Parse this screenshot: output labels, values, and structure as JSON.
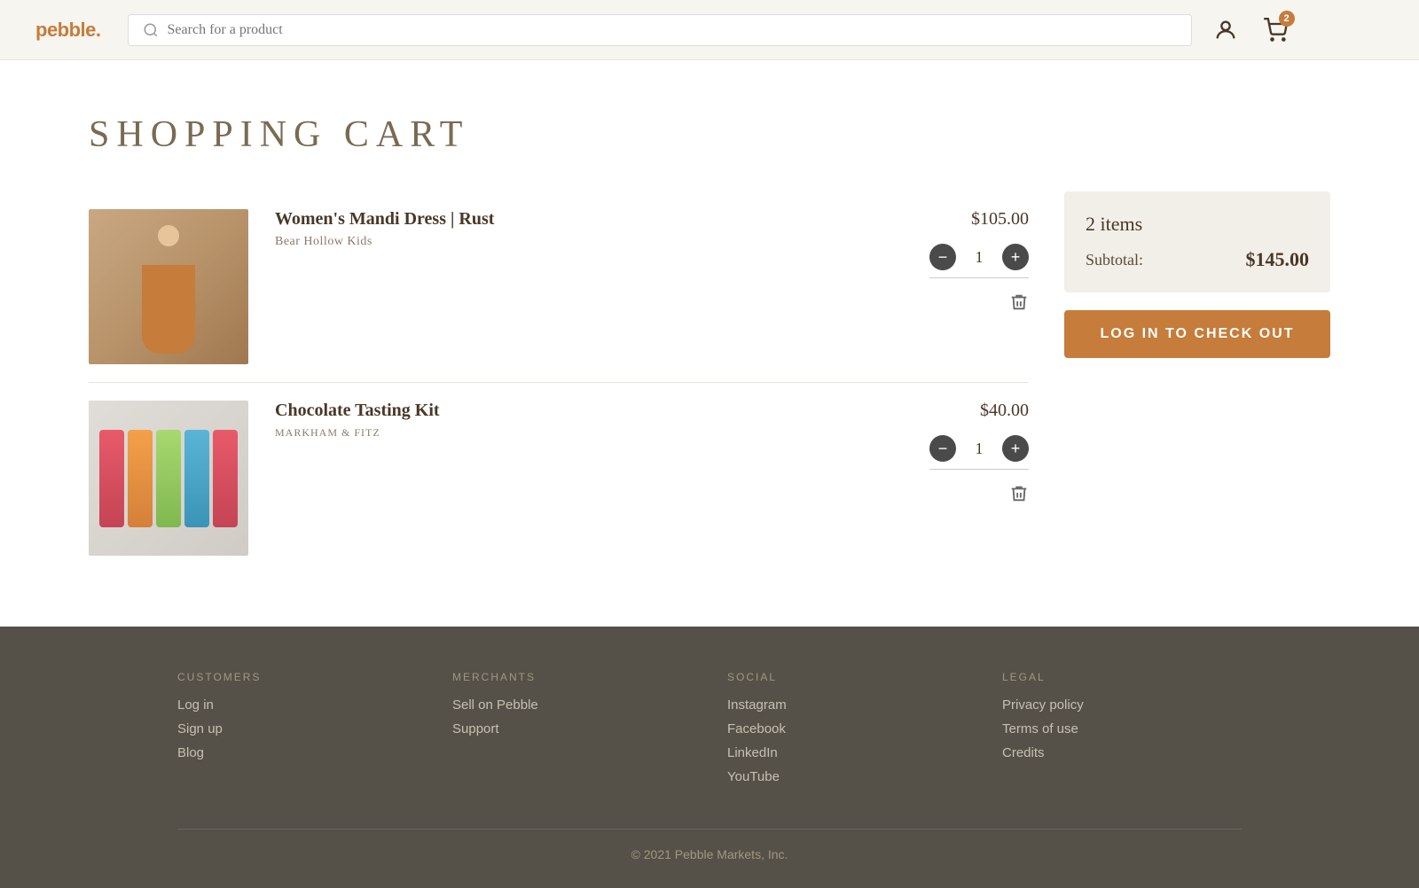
{
  "header": {
    "logo_text": "pebble.",
    "search_placeholder": "Search for a product",
    "cart_badge": "2"
  },
  "page": {
    "title": "SHOPPING CART"
  },
  "cart": {
    "items": [
      {
        "id": "item-1",
        "name": "Women's Mandi Dress | Rust",
        "vendor": "Bear Hollow Kids",
        "vendor_caps": false,
        "price": "$105.00",
        "quantity": 1,
        "image_type": "dress"
      },
      {
        "id": "item-2",
        "name": "Chocolate Tasting Kit",
        "vendor": "MARKHAM & FITZ",
        "vendor_caps": true,
        "price": "$40.00",
        "quantity": 1,
        "image_type": "choc"
      }
    ]
  },
  "summary": {
    "items_count": "2 items",
    "subtotal_label": "Subtotal:",
    "subtotal_amount": "$145.00",
    "checkout_label": "LOG IN TO CHECK OUT"
  },
  "footer": {
    "columns": [
      {
        "title": "CUSTOMERS",
        "links": [
          "Log in",
          "Sign up",
          "Blog"
        ]
      },
      {
        "title": "MERCHANTS",
        "links": [
          "Sell on Pebble",
          "Support"
        ]
      },
      {
        "title": "SOCIAL",
        "links": [
          "Instagram",
          "Facebook",
          "LinkedIn",
          "YouTube"
        ]
      },
      {
        "title": "LEGAL",
        "links": [
          "Privacy policy",
          "Terms of use",
          "Credits"
        ]
      }
    ],
    "copyright": "© 2021 Pebble Markets, Inc."
  }
}
